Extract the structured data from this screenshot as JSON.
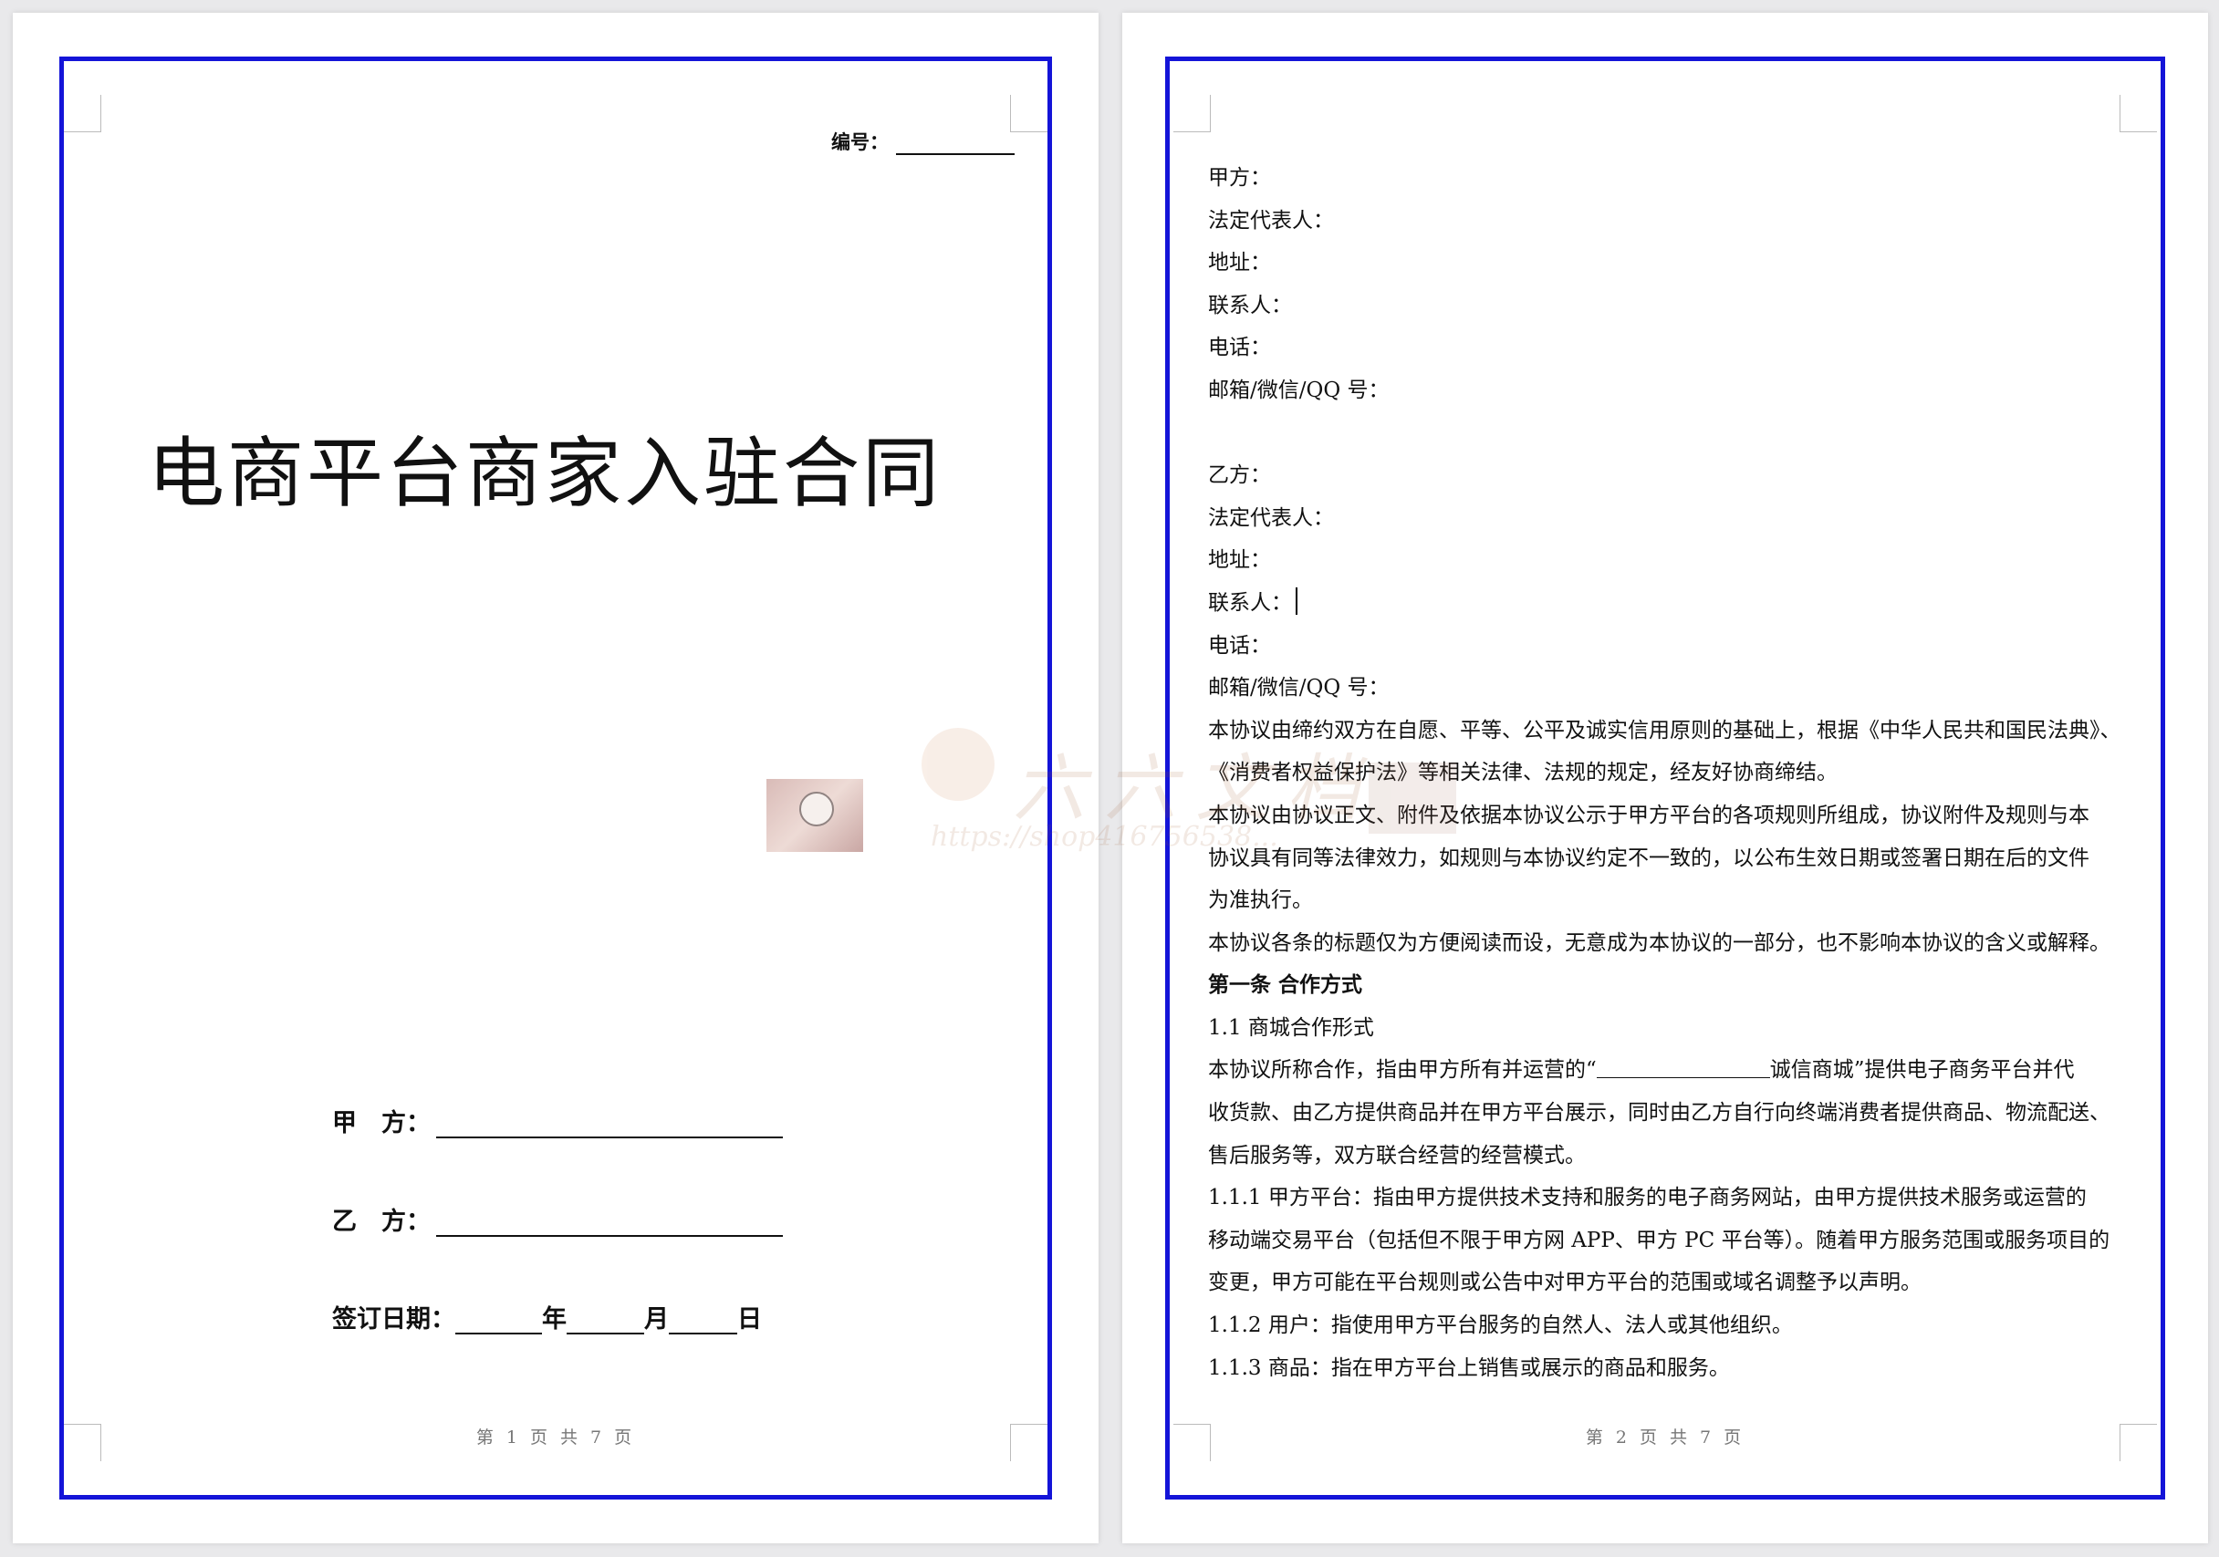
{
  "page1": {
    "serial_label": "编号：",
    "title": "电商平台商家入驻合同",
    "party_a_label": "甲　方：",
    "party_b_label": "乙　方：",
    "sign_date_label": "签订日期：",
    "year_label": "年",
    "month_label": "月",
    "day_label": "日",
    "footer": "第 1 页 共 7 页"
  },
  "page2": {
    "lines": [
      "甲方：",
      "法定代表人：",
      "地址：",
      "联系人：",
      "电话：",
      "邮箱/微信/QQ 号：",
      "",
      "乙方：",
      "法定代表人：",
      "地址：",
      "联系人：",
      "电话：",
      "邮箱/微信/QQ 号：",
      "本协议由缔约双方在自愿、平等、公平及诚实信用原则的基础上，根据《中华人民共和国民法典》、",
      "《消费者权益保护法》等相关法律、法规的规定，经友好协商缔结。",
      "本协议由协议正文、附件及依据本协议公示于甲方平台的各项规则所组成，协议附件及规则与本",
      "协议具有同等法律效力，如规则与本协议约定不一致的，以公布生效日期或签署日期在后的文件",
      "为准执行。",
      "本协议各条的标题仅为方便阅读而设，无意成为本协议的一部分，也不影响本协议的含义或解释。",
      "第一条 合作方式",
      "1.1 商城合作形式",
      "诚信商城”提供电子商务平台并代",
      "收货款、由乙方提供商品并在甲方平台展示，同时由乙方自行向终端消费者提供商品、物流配送、",
      "售后服务等，双方联合经营的经营模式。",
      "1.1.1 甲方平台：指由甲方提供技术支持和服务的电子商务网站，由甲方提供技术服务或运营的",
      "移动端交易平台（包括但不限于甲方网 APP、甲方 PC 平台等）。随着甲方服务范围或服务项目的",
      "变更，甲方可能在平台规则或公告中对甲方平台的范围或域名调整予以声明。",
      "1.1.2 用户：指使用甲方平台服务的自然人、法人或其他组织。",
      "1.1.3 商品：指在甲方平台上销售或展示的商品和服务。"
    ],
    "line_22_prefix": "本协议所称合作，指由甲方所有并运营的“",
    "footer": "第 2 页 共 7 页"
  },
  "watermark": {
    "main": "六六文档",
    "sub": "https://shop416756538..."
  }
}
